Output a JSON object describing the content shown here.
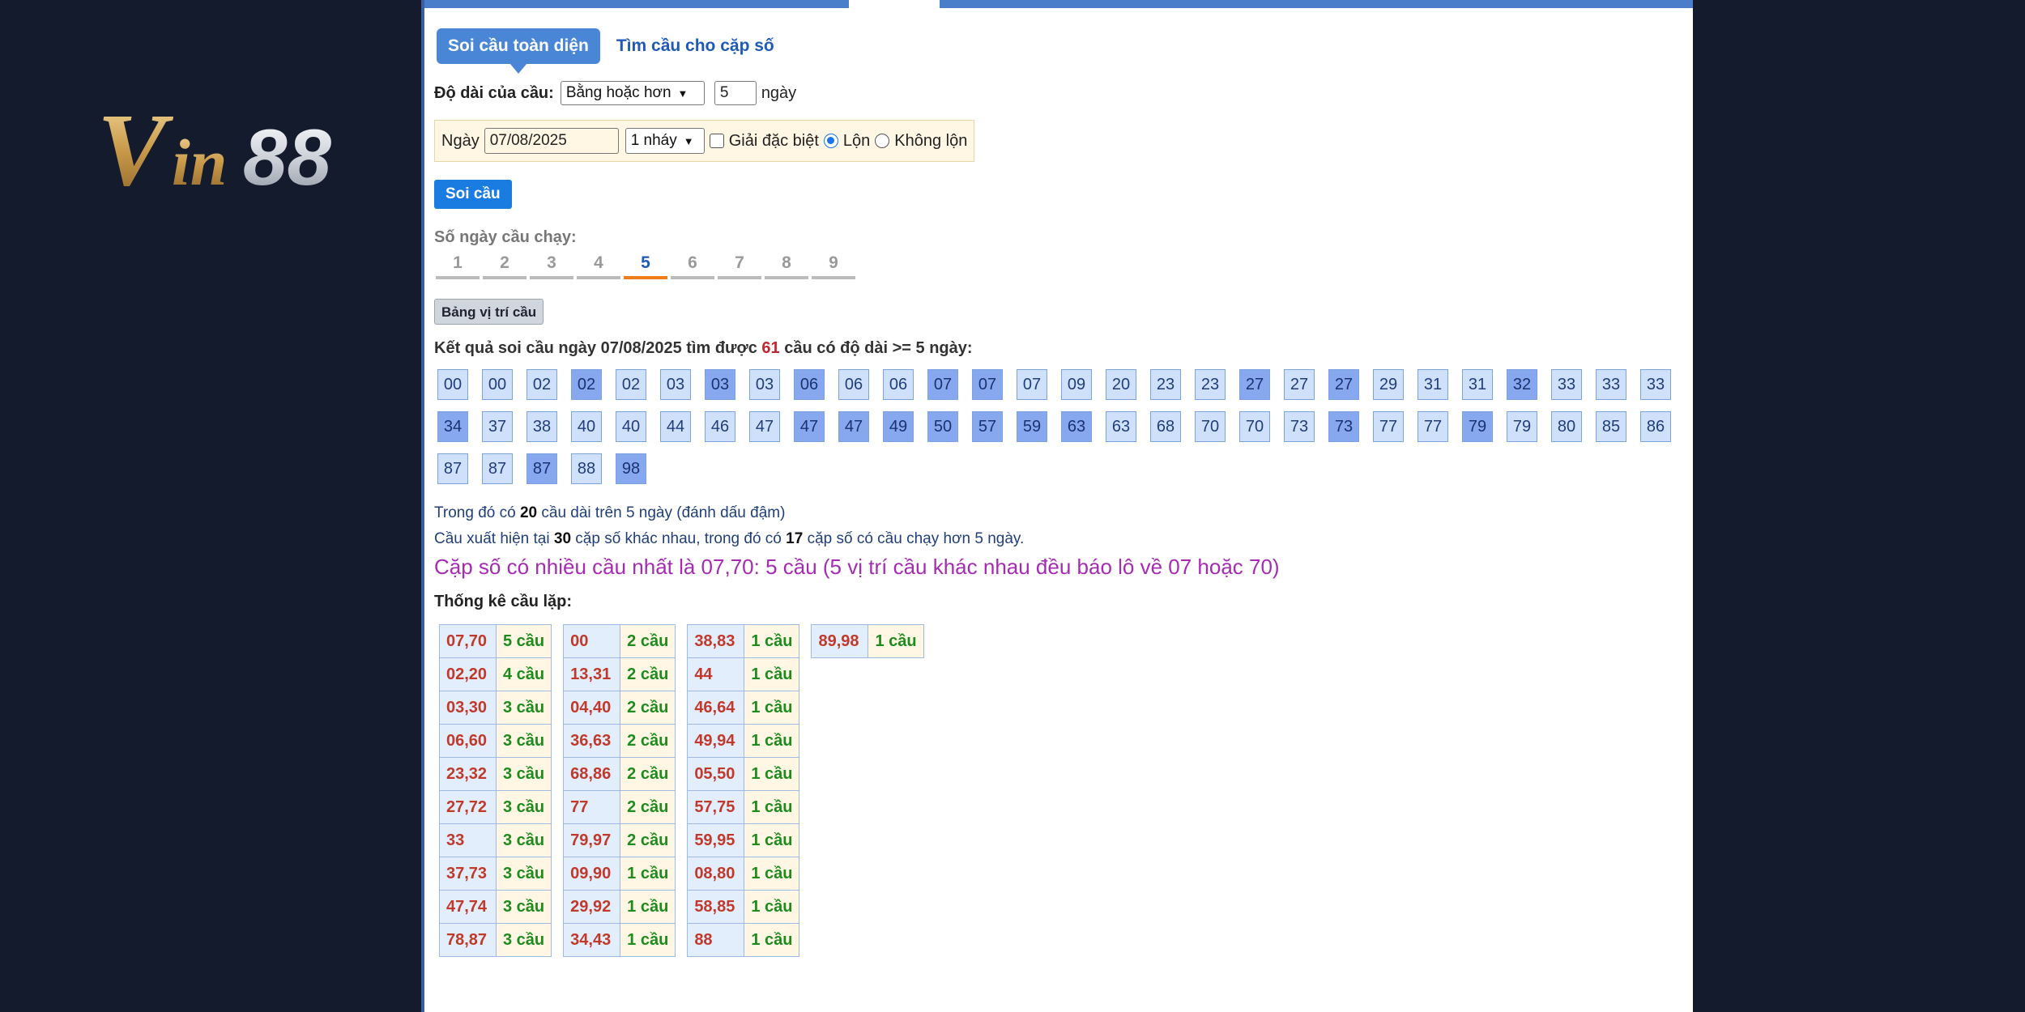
{
  "logo": {
    "text": "Vin88"
  },
  "tabs": [
    {
      "label": "Soi cầu toàn diện",
      "active": true
    },
    {
      "label": "Tìm cầu cho cặp số",
      "active": false
    }
  ],
  "length_row": {
    "label": "Độ dài của cầu:",
    "mode": "Bằng hoặc hơn",
    "value": "5",
    "unit": "ngày"
  },
  "filter": {
    "date_label": "Ngày",
    "date": "07/08/2025",
    "nhay": "1 nháy",
    "special_label": "Giải đặc biệt",
    "lon_label": "Lộn",
    "khong_lon_label": "Không lộn",
    "selected": "Lộn"
  },
  "soi_button": "Soi cầu",
  "days_label": "Số ngày cầu chạy:",
  "days": [
    "1",
    "2",
    "3",
    "4",
    "5",
    "6",
    "7",
    "8",
    "9"
  ],
  "active_day": "5",
  "bang_button": "Bảng vị trí cầu",
  "result": {
    "prefix": "Kết quả soi cầu ngày 07/08/2025 tìm được",
    "count": "61",
    "suffix": "cầu có độ dài >= 5 ngày:"
  },
  "numbers": [
    {
      "v": "00",
      "d": false
    },
    {
      "v": "00",
      "d": false
    },
    {
      "v": "02",
      "d": false
    },
    {
      "v": "02",
      "d": true
    },
    {
      "v": "02",
      "d": false
    },
    {
      "v": "03",
      "d": false
    },
    {
      "v": "03",
      "d": true
    },
    {
      "v": "03",
      "d": false
    },
    {
      "v": "06",
      "d": true
    },
    {
      "v": "06",
      "d": false
    },
    {
      "v": "06",
      "d": false
    },
    {
      "v": "07",
      "d": true
    },
    {
      "v": "07",
      "d": true
    },
    {
      "v": "07",
      "d": false
    },
    {
      "v": "09",
      "d": false
    },
    {
      "v": "20",
      "d": false
    },
    {
      "v": "23",
      "d": false
    },
    {
      "v": "23",
      "d": false
    },
    {
      "v": "27",
      "d": true
    },
    {
      "v": "27",
      "d": false
    },
    {
      "v": "27",
      "d": true
    },
    {
      "v": "29",
      "d": false
    },
    {
      "v": "31",
      "d": false
    },
    {
      "v": "31",
      "d": false
    },
    {
      "v": "32",
      "d": true
    },
    {
      "v": "33",
      "d": false
    },
    {
      "v": "33",
      "d": false
    },
    {
      "v": "33",
      "d": false
    },
    {
      "v": "34",
      "d": true
    },
    {
      "v": "37",
      "d": false
    },
    {
      "v": "38",
      "d": false
    },
    {
      "v": "40",
      "d": false
    },
    {
      "v": "40",
      "d": false
    },
    {
      "v": "44",
      "d": false
    },
    {
      "v": "46",
      "d": false
    },
    {
      "v": "47",
      "d": false
    },
    {
      "v": "47",
      "d": true
    },
    {
      "v": "47",
      "d": true
    },
    {
      "v": "49",
      "d": true
    },
    {
      "v": "50",
      "d": true
    },
    {
      "v": "57",
      "d": true
    },
    {
      "v": "59",
      "d": true
    },
    {
      "v": "63",
      "d": true
    },
    {
      "v": "63",
      "d": false
    },
    {
      "v": "68",
      "d": false
    },
    {
      "v": "70",
      "d": false
    },
    {
      "v": "70",
      "d": false
    },
    {
      "v": "73",
      "d": false
    },
    {
      "v": "73",
      "d": true
    },
    {
      "v": "77",
      "d": false
    },
    {
      "v": "77",
      "d": false
    },
    {
      "v": "79",
      "d": true
    },
    {
      "v": "79",
      "d": false
    },
    {
      "v": "80",
      "d": false
    },
    {
      "v": "85",
      "d": false
    },
    {
      "v": "86",
      "d": false
    },
    {
      "v": "87",
      "d": false
    },
    {
      "v": "87",
      "d": false
    },
    {
      "v": "87",
      "d": true
    },
    {
      "v": "88",
      "d": false
    },
    {
      "v": "98",
      "d": true
    }
  ],
  "info": {
    "l1_a": "Trong đó có",
    "l1_b": "20",
    "l1_c": "cầu dài trên 5 ngày (đánh dấu đậm)",
    "l2_a": "Cầu xuất hiện tại",
    "l2_b": "30",
    "l2_c": "cặp số khác nhau, trong đó có",
    "l2_d": "17",
    "l2_e": "cặp số có cầu chạy hơn 5 ngày.",
    "big": "Cặp số có nhiều cầu nhất là 07,70: 5 cầu (5 vị trí cầu khác nhau đều báo lô về 07 hoặc 70)"
  },
  "stats_title": "Thống kê cầu lặp:",
  "stats": [
    [
      [
        "07,70",
        "5 cầu"
      ],
      [
        "02,20",
        "4 cầu"
      ],
      [
        "03,30",
        "3 cầu"
      ],
      [
        "06,60",
        "3 cầu"
      ],
      [
        "23,32",
        "3 cầu"
      ],
      [
        "27,72",
        "3 cầu"
      ],
      [
        "33",
        "3 cầu"
      ],
      [
        "37,73",
        "3 cầu"
      ],
      [
        "47,74",
        "3 cầu"
      ],
      [
        "78,87",
        "3 cầu"
      ]
    ],
    [
      [
        "00",
        "2 cầu"
      ],
      [
        "13,31",
        "2 cầu"
      ],
      [
        "04,40",
        "2 cầu"
      ],
      [
        "36,63",
        "2 cầu"
      ],
      [
        "68,86",
        "2 cầu"
      ],
      [
        "77",
        "2 cầu"
      ],
      [
        "79,97",
        "2 cầu"
      ],
      [
        "09,90",
        "1 cầu"
      ],
      [
        "29,92",
        "1 cầu"
      ],
      [
        "34,43",
        "1 cầu"
      ]
    ],
    [
      [
        "38,83",
        "1 cầu"
      ],
      [
        "44",
        "1 cầu"
      ],
      [
        "46,64",
        "1 cầu"
      ],
      [
        "49,94",
        "1 cầu"
      ],
      [
        "05,50",
        "1 cầu"
      ],
      [
        "57,75",
        "1 cầu"
      ],
      [
        "59,95",
        "1 cầu"
      ],
      [
        "08,80",
        "1 cầu"
      ],
      [
        "58,85",
        "1 cầu"
      ],
      [
        "88",
        "1 cầu"
      ]
    ],
    [
      [
        "89,98",
        "1 cầu"
      ]
    ]
  ]
}
